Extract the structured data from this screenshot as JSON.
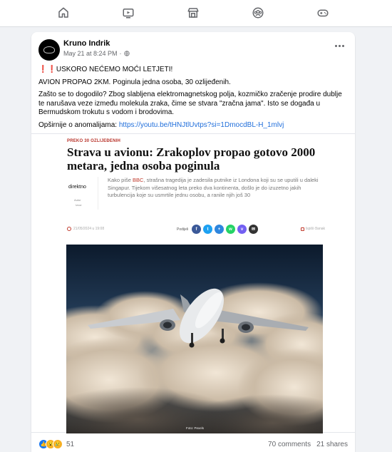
{
  "nav": {
    "items": [
      {
        "icon": "home-icon"
      },
      {
        "icon": "video-icon"
      },
      {
        "icon": "marketplace-icon"
      },
      {
        "icon": "groups-icon"
      },
      {
        "icon": "gaming-icon"
      }
    ]
  },
  "post": {
    "author": "Kruno Indrik",
    "date": "May 21 at 8:24 PM",
    "visibility_separator": "·",
    "visibility_icon": "globe-icon",
    "menu_icon": "more-options-icon",
    "line1_marks": "❗❗",
    "line1": "USKORO NEĆEMO MOĆI LETJETI!",
    "line2": "AVION PROPAO 2KM. Poginula jedna osoba, 30 ozlijeđenih.",
    "paragraph": "Zašto se to dogodilo? Zbog slabljena elektromagnetskog polja, kozmičko zračenje prodire dublje te narušava veze između molekula zraka, čime se stvara \"zračna jama\". Isto se događa u Bermudskom trokutu s vodom i brodovima.",
    "more_label": "Opširnije o anomalijama:",
    "more_link": "https://youtu.be/tHNJtlUvtps?si=1DmocdBL-H_1mlvj"
  },
  "article": {
    "badge": "PREKO 30 OZLIJEĐENIH",
    "headline": "Strava u avionu: Zrakoplov propao gotovo 2000 metara, jedna osoba poginula",
    "source_logo": "direktno",
    "source_sub1": "Autor",
    "source_sub2": "Izvor",
    "lead_before": "Kako piše ",
    "lead_bbc": "BBC",
    "lead_after": ", strašna tragedija je zadesila putnike iz Londona koji su se uputili u daleki Singapur. Tijekom višesatnog leta preko dva kontinenta, došlo je do izuzetno jakih turbulencija koje su usmrtile jednu osobu, a ranile njih još 30",
    "date": "21/05/2024 u 19:08",
    "share_label": "Podijeli",
    "share_buttons": [
      {
        "icon": "facebook-icon",
        "glyph": "f",
        "color": "#3b5998"
      },
      {
        "icon": "twitter-icon",
        "glyph": "t",
        "color": "#1da1f2"
      },
      {
        "icon": "share-icon",
        "glyph": "+",
        "color": "#2e86de"
      },
      {
        "icon": "whatsapp-icon",
        "glyph": "w",
        "color": "#25d366"
      },
      {
        "icon": "viber-icon",
        "glyph": "v",
        "color": "#7360f2"
      },
      {
        "icon": "email-icon",
        "glyph": "✉",
        "color": "#333333"
      }
    ],
    "print_label": "Ispiši članak",
    "photo_caption": "Foto: Pexels"
  },
  "footer": {
    "reactions": [
      {
        "icon": "like-reaction-icon",
        "glyph": "👍",
        "color": "#1877f2"
      },
      {
        "icon": "wow-reaction-icon",
        "glyph": "😮",
        "color": "#f7b125"
      },
      {
        "icon": "sad-reaction-icon",
        "glyph": "😢",
        "color": "#f7b125"
      }
    ],
    "reaction_count": "51",
    "comments": "70 comments",
    "shares": "21 shares"
  }
}
